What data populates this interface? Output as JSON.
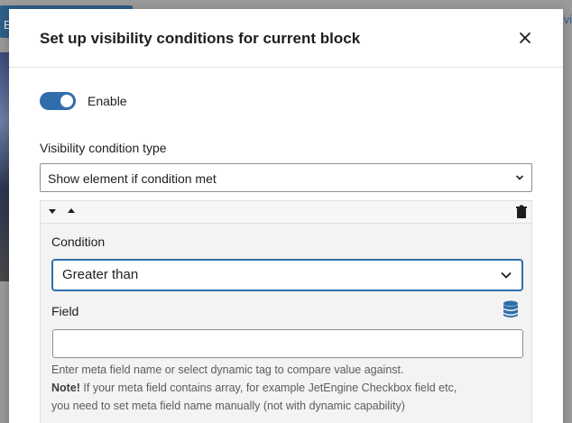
{
  "background": {
    "button_letter": "E",
    "right_text": "vi"
  },
  "modal": {
    "title": "Set up visibility conditions for current block",
    "close_label": "×",
    "enable_label": "Enable",
    "enabled": true,
    "visibility_type_label": "Visibility condition type",
    "visibility_type_value": "Show element if condition met",
    "repeater": {
      "condition_label": "Condition",
      "condition_value": "Greater than",
      "field_label": "Field",
      "field_value": "",
      "help_line1": "Enter meta field name or select dynamic tag to compare value against.",
      "help_note_strong": "Note!",
      "help_note_rest": " If your meta field contains array, for example JetEngine Checkbox field etc,",
      "help_line3": "you need to set meta field name manually (not with dynamic capability)"
    }
  },
  "colors": {
    "accent": "#2f6eaa",
    "overlay": "#9b9b9b"
  },
  "icons": {
    "close": "close-icon",
    "chevron": "chevron-down-icon",
    "collapse": "triangle-down-icon",
    "expand": "triangle-up-icon",
    "trash": "trash-icon",
    "database": "database-icon"
  }
}
